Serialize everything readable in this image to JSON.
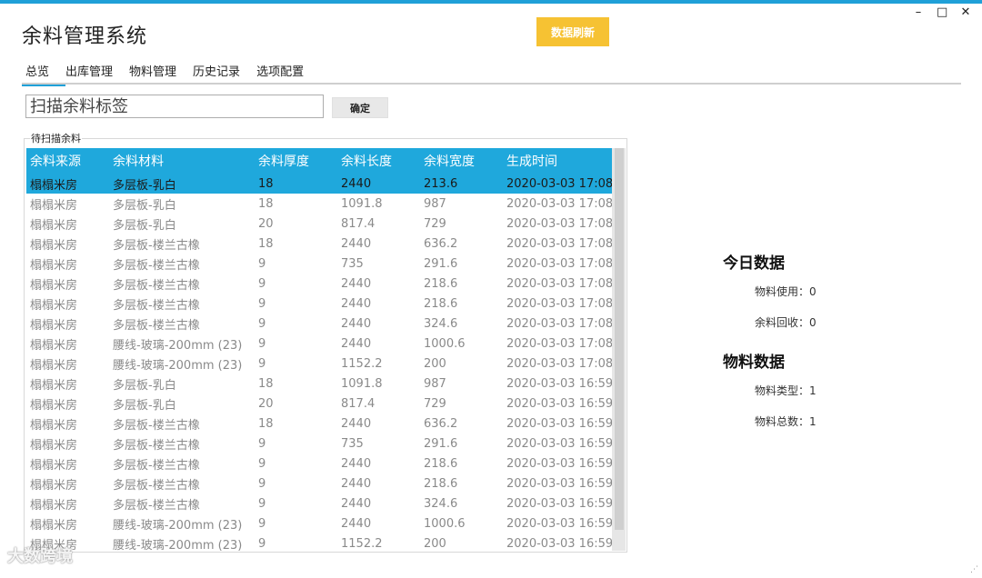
{
  "window": {
    "title": "余料管理系统",
    "minimize": "–",
    "maximize": "□",
    "close": "✕"
  },
  "toolbar": {
    "refresh_label": "数据刷新"
  },
  "tabs": [
    {
      "label": "总览"
    },
    {
      "label": "出库管理"
    },
    {
      "label": "物料管理"
    },
    {
      "label": "历史记录"
    },
    {
      "label": "选项配置"
    }
  ],
  "scan": {
    "placeholder": "扫描余料标签",
    "confirm_label": "确定"
  },
  "table": {
    "group_label": "待扫描余料",
    "headers": [
      "余料来源",
      "余料材料",
      "余料厚度",
      "余料长度",
      "余料宽度",
      "生成时间"
    ],
    "rows": [
      [
        "榻榻米房",
        "多层板-乳白",
        "18",
        "2440",
        "213.6",
        "2020-03-03 17:08"
      ],
      [
        "榻榻米房",
        "多层板-乳白",
        "18",
        "1091.8",
        "987",
        "2020-03-03 17:08"
      ],
      [
        "榻榻米房",
        "多层板-乳白",
        "20",
        "817.4",
        "729",
        "2020-03-03 17:08"
      ],
      [
        "榻榻米房",
        "多层板-楼兰古橡",
        "18",
        "2440",
        "636.2",
        "2020-03-03 17:08"
      ],
      [
        "榻榻米房",
        "多层板-楼兰古橡",
        "9",
        "735",
        "291.6",
        "2020-03-03 17:08"
      ],
      [
        "榻榻米房",
        "多层板-楼兰古橡",
        "9",
        "2440",
        "218.6",
        "2020-03-03 17:08"
      ],
      [
        "榻榻米房",
        "多层板-楼兰古橡",
        "9",
        "2440",
        "218.6",
        "2020-03-03 17:08"
      ],
      [
        "榻榻米房",
        "多层板-楼兰古橡",
        "9",
        "2440",
        "324.6",
        "2020-03-03 17:08"
      ],
      [
        "榻榻米房",
        "腰线-玻璃-200mm (23)",
        "9",
        "2440",
        "1000.6",
        "2020-03-03 17:08"
      ],
      [
        "榻榻米房",
        "腰线-玻璃-200mm (23)",
        "9",
        "1152.2",
        "200",
        "2020-03-03 17:08"
      ],
      [
        "榻榻米房",
        "多层板-乳白",
        "18",
        "1091.8",
        "987",
        "2020-03-03 16:59"
      ],
      [
        "榻榻米房",
        "多层板-乳白",
        "20",
        "817.4",
        "729",
        "2020-03-03 16:59"
      ],
      [
        "榻榻米房",
        "多层板-楼兰古橡",
        "18",
        "2440",
        "636.2",
        "2020-03-03 16:59"
      ],
      [
        "榻榻米房",
        "多层板-楼兰古橡",
        "9",
        "735",
        "291.6",
        "2020-03-03 16:59"
      ],
      [
        "榻榻米房",
        "多层板-楼兰古橡",
        "9",
        "2440",
        "218.6",
        "2020-03-03 16:59"
      ],
      [
        "榻榻米房",
        "多层板-楼兰古橡",
        "9",
        "2440",
        "218.6",
        "2020-03-03 16:59"
      ],
      [
        "榻榻米房",
        "多层板-楼兰古橡",
        "9",
        "2440",
        "324.6",
        "2020-03-03 16:59"
      ],
      [
        "榻榻米房",
        "腰线-玻璃-200mm (23)",
        "9",
        "2440",
        "1000.6",
        "2020-03-03 16:59"
      ],
      [
        "榻榻米房",
        "腰线-玻璃-200mm (23)",
        "9",
        "1152.2",
        "200",
        "2020-03-03 16:59"
      ]
    ]
  },
  "today": {
    "title": "今日数据",
    "material_used": "物料使用：0",
    "scrap_recycled": "余料回收：0"
  },
  "materials": {
    "title": "物料数据",
    "type_count": "物料类型：1",
    "total_count": "物料总数：1"
  },
  "watermark": "大数跨境",
  "colors": {
    "accent": "#1fa8dc",
    "refresh_button": "#f6c233"
  }
}
